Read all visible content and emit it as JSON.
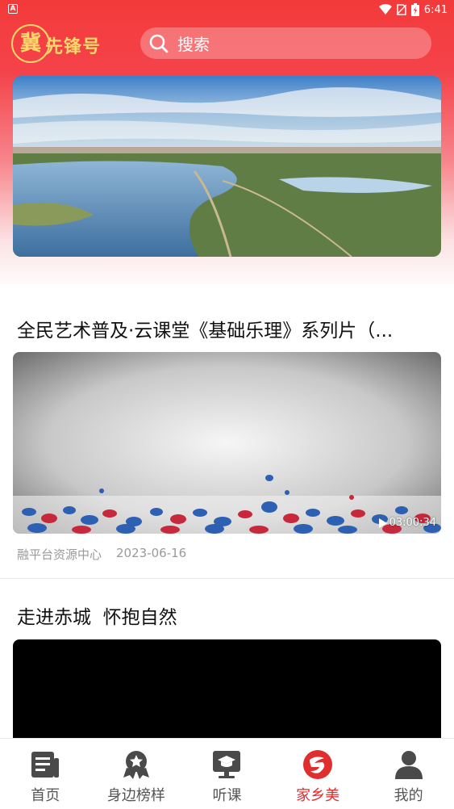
{
  "status_bar": {
    "time": "6:41",
    "left_badge": "A"
  },
  "app": {
    "logo_char": "冀",
    "logo_text": "先锋号"
  },
  "search": {
    "placeholder": "搜索"
  },
  "articles": [
    {
      "title": "全民艺术普及·云课堂《基础乐理》系列片（...",
      "duration": "03:00:34",
      "source": "融平台资源中心",
      "date": "2023-06-16"
    },
    {
      "title": "走进赤城  怀抱自然"
    }
  ],
  "tabs": [
    {
      "label": "首页",
      "icon": "news-icon"
    },
    {
      "label": "身边榜样",
      "icon": "medal-icon"
    },
    {
      "label": "听课",
      "icon": "lecture-icon"
    },
    {
      "label": "家乡美",
      "icon": "hometown-icon",
      "active": true
    },
    {
      "label": "我的",
      "icon": "user-icon"
    }
  ],
  "colors": {
    "brand_red": "#f33a3a",
    "active_tab": "#e02d2d",
    "logo_gold": "#ffd86b"
  }
}
